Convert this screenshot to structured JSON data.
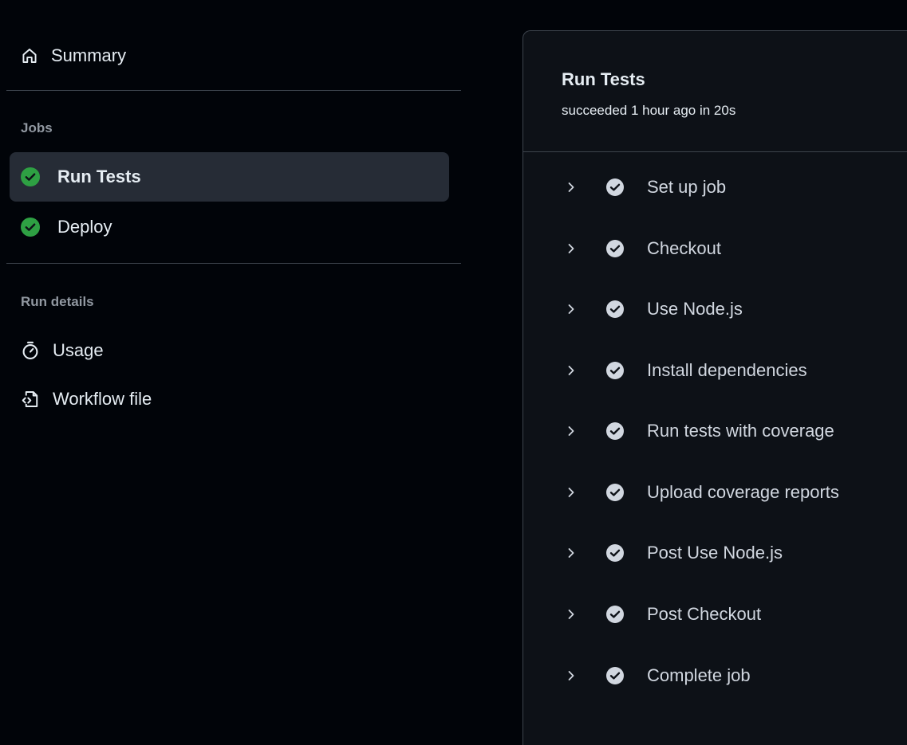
{
  "sidebar": {
    "summary": {
      "label": "Summary",
      "icon": "home-icon"
    },
    "jobs_heading": "Jobs",
    "jobs": [
      {
        "label": "Run Tests",
        "status": "success",
        "active": true
      },
      {
        "label": "Deploy",
        "status": "success",
        "active": false
      }
    ],
    "run_details_heading": "Run details",
    "details": [
      {
        "label": "Usage",
        "icon": "stopwatch-icon"
      },
      {
        "label": "Workflow file",
        "icon": "file-code-icon"
      }
    ]
  },
  "job": {
    "title": "Run Tests",
    "subtitle": "succeeded 1 hour ago in 20s",
    "steps": [
      {
        "label": "Set up job"
      },
      {
        "label": "Checkout"
      },
      {
        "label": "Use Node.js"
      },
      {
        "label": "Install dependencies"
      },
      {
        "label": "Run tests with coverage"
      },
      {
        "label": "Upload coverage reports"
      },
      {
        "label": "Post Use Node.js"
      },
      {
        "label": "Post Checkout"
      },
      {
        "label": "Complete job"
      }
    ]
  },
  "colors": {
    "background": "#010409",
    "panel": "#0d1117",
    "border": "#3d444d",
    "active_item": "#262c36",
    "success_green": "#2ea043",
    "step_check": "#d1d7e0",
    "muted_text": "#9198a1"
  }
}
